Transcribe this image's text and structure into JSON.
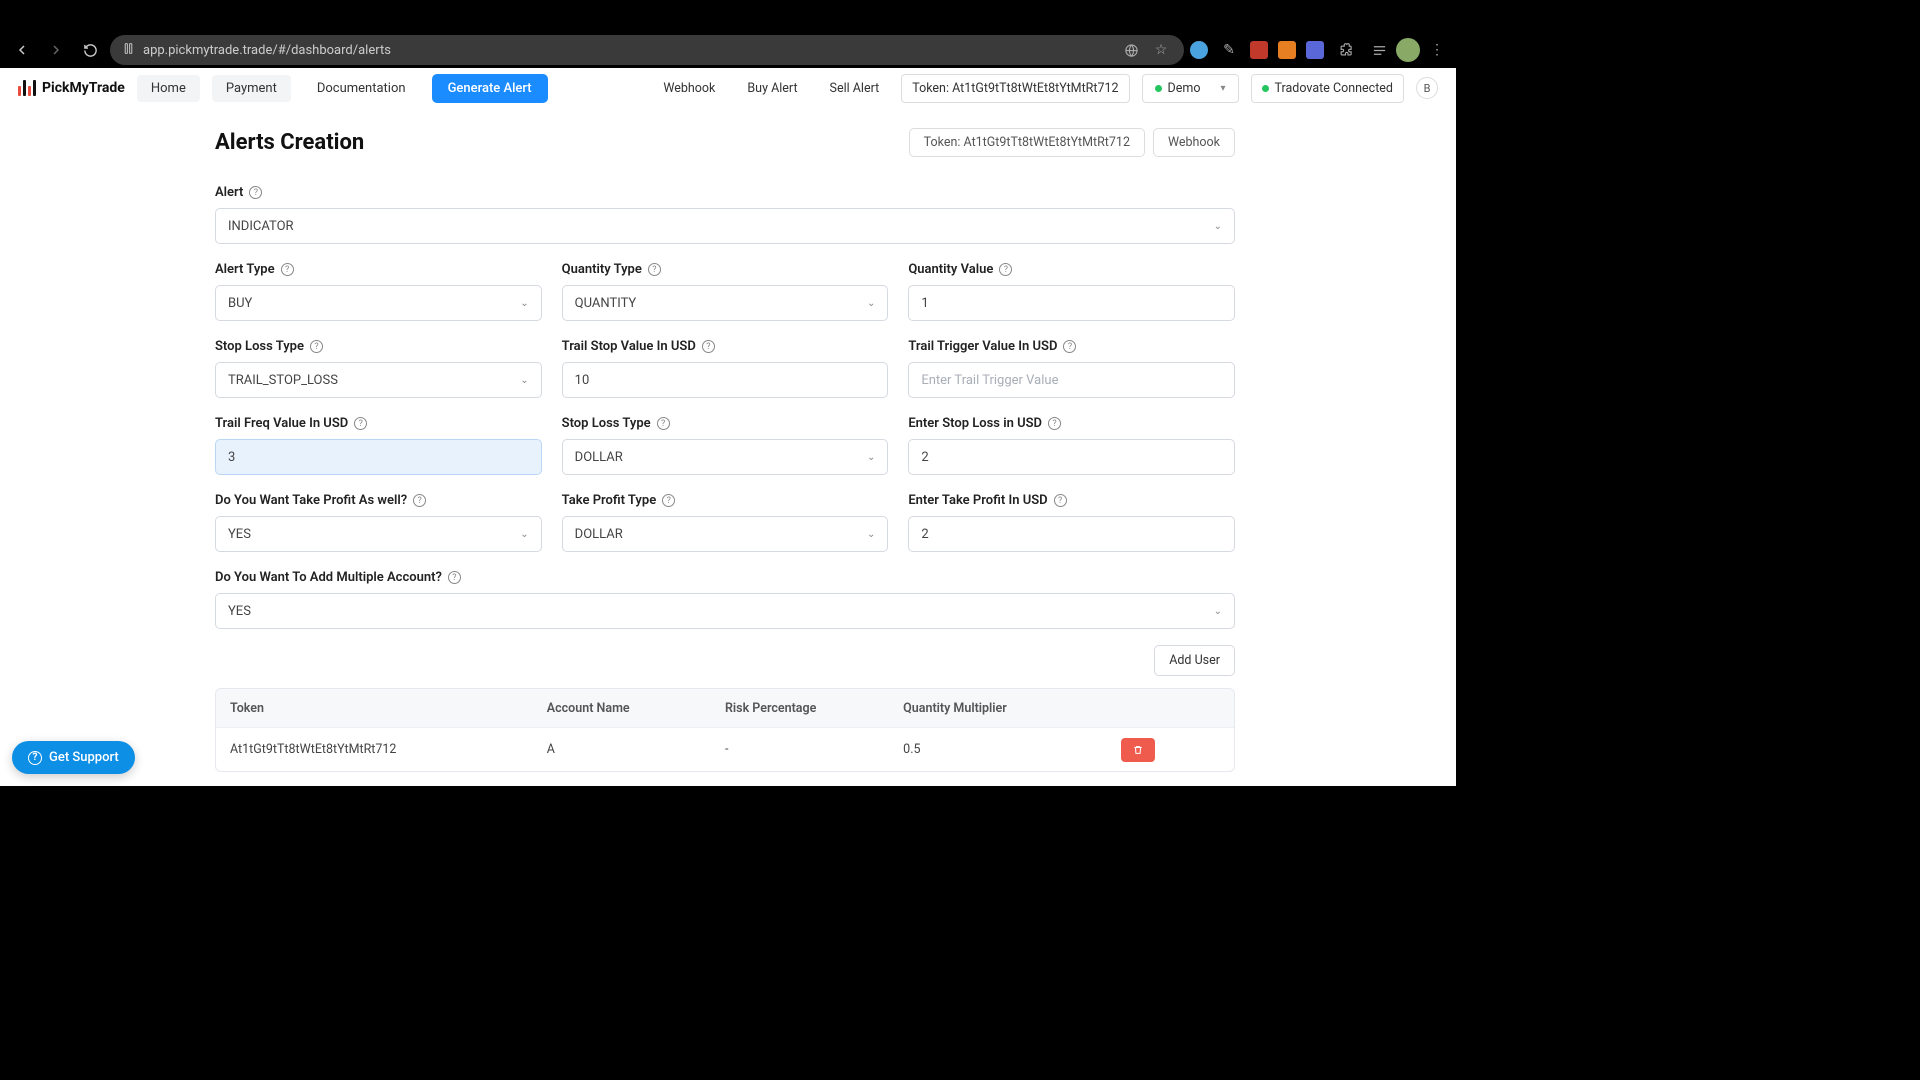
{
  "browser": {
    "url": "app.pickmytrade.trade/#/dashboard/alerts"
  },
  "header": {
    "brand": "PickMyTrade",
    "nav": {
      "home": "Home",
      "payment": "Payment",
      "docs": "Documentation"
    },
    "generate": "Generate Alert",
    "webhook": "Webhook",
    "buy_alert": "Buy Alert",
    "sell_alert": "Sell Alert",
    "token_label": "Token: At1tGt9tTt8tWtEt8tYtMtRt712",
    "account_mode": "Demo",
    "status": "Tradovate Connected",
    "avatar_letter": "B"
  },
  "title": {
    "text": "Alerts Creation",
    "token_badge": "Token: At1tGt9tTt8tWtEt8tYtMtRt712",
    "webhook_badge": "Webhook"
  },
  "form": {
    "alert_label": "Alert",
    "alert_value": "INDICATOR",
    "alert_type_label": "Alert Type",
    "alert_type_value": "BUY",
    "qty_type_label": "Quantity Type",
    "qty_type_value": "QUANTITY",
    "qty_val_label": "Quantity Value",
    "qty_val_value": "1",
    "sl_type_label": "Stop Loss Type",
    "sl_type_value": "TRAIL_STOP_LOSS",
    "trail_stop_label": "Trail Stop Value In USD",
    "trail_stop_value": "10",
    "trail_trigger_label": "Trail Trigger Value In USD",
    "trail_trigger_placeholder": "Enter Trail Trigger Value",
    "trail_freq_label": "Trail Freq Value In USD",
    "trail_freq_value": "3",
    "sl_type2_label": "Stop Loss Type",
    "sl_type2_value": "DOLLAR",
    "sl_usd_label": "Enter Stop Loss in USD",
    "sl_usd_value": "2",
    "tp_want_label": "Do You Want Take Profit As well?",
    "tp_want_value": "YES",
    "tp_type_label": "Take Profit Type",
    "tp_type_value": "DOLLAR",
    "tp_usd_label": "Enter Take Profit In USD",
    "tp_usd_value": "2",
    "multi_label": "Do You Want To Add Multiple Account?",
    "multi_value": "YES"
  },
  "add_user_btn": "Add User",
  "table": {
    "headers": {
      "token": "Token",
      "account": "Account Name",
      "risk": "Risk Percentage",
      "qty": "Quantity Multiplier"
    },
    "row": {
      "token": "At1tGt9tTt8tWtEt8tYtMtRt712",
      "account": "A",
      "risk": "-",
      "qty": "0.5"
    }
  },
  "support": "Get Support"
}
